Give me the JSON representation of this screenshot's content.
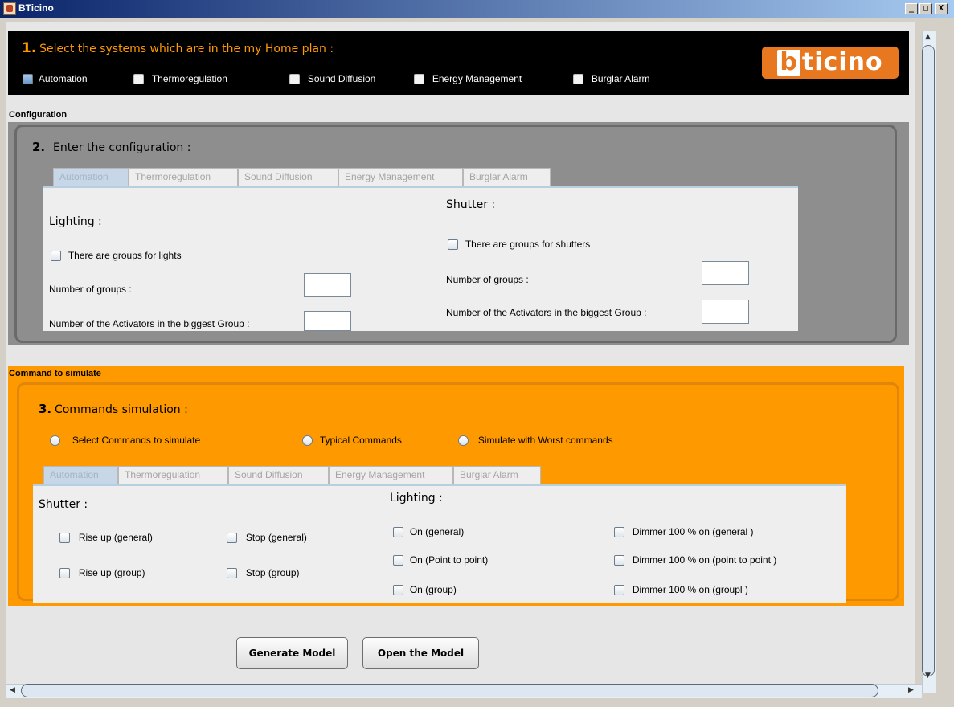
{
  "window": {
    "title": "BTicino",
    "controls": {
      "minimize": "_",
      "maximize": "□",
      "close": "X"
    }
  },
  "section1": {
    "number": "1.",
    "heading": "Select the systems which are in the my Home plan :",
    "systems": [
      {
        "label": "Automation",
        "checked": false
      },
      {
        "label": "Thermoregulation",
        "checked": false
      },
      {
        "label": "Sound Diffusion",
        "checked": false
      },
      {
        "label": "Energy Management",
        "checked": false
      },
      {
        "label": "Burglar Alarm",
        "checked": false
      }
    ],
    "logo": {
      "highlight": "b",
      "rest": "ticino"
    }
  },
  "configuration": {
    "header": "Configuration",
    "number": "2.",
    "heading": "Enter the configuration :",
    "tabs": [
      "Automation",
      "Thermoregulation",
      "Sound Diffusion",
      "Energy Management",
      "Burglar Alarm"
    ],
    "selected_tab": "Automation",
    "lighting": {
      "title": "Lighting :",
      "groups_checkbox": "There are groups for lights",
      "num_groups_label": "Number of groups :",
      "num_activators_label": "Number of the Activators in the biggest Group :",
      "num_groups_value": "",
      "num_activators_value": ""
    },
    "shutter": {
      "title": "Shutter :",
      "groups_checkbox": "There are groups for shutters",
      "num_groups_label": "Number of groups :",
      "num_activators_label": "Number of the Activators in the biggest Group :",
      "num_groups_value": "",
      "num_activators_value": ""
    }
  },
  "commands": {
    "header": "Command to simulate",
    "number": "3.",
    "heading": "Commands simulation :",
    "modes": [
      "Select Commands to simulate",
      "Typical Commands",
      "Simulate with Worst commands"
    ],
    "tabs": [
      "Automation",
      "Thermoregulation",
      "Sound Diffusion",
      "Energy Management",
      "Burglar Alarm"
    ],
    "selected_tab": "Automation",
    "shutter": {
      "title": "Shutter :",
      "items": [
        "Rise up (general)",
        "Stop (general)",
        "Rise up (group)",
        "Stop (group)"
      ]
    },
    "lighting": {
      "title": "Lighting :",
      "items": [
        "On (general)",
        "On (Point to point)",
        "On (group)"
      ],
      "dimmer_items": [
        "Dimmer 100 % on (general )",
        "Dimmer 100 % on (point to point )",
        "Dimmer 100 % on (groupl )"
      ]
    }
  },
  "buttons": {
    "generate": "Generate Model",
    "open": "Open the Model"
  },
  "colors": {
    "accent_orange": "#ff9900",
    "config_bg": "#8e8e8e",
    "header_bg": "#000000"
  }
}
